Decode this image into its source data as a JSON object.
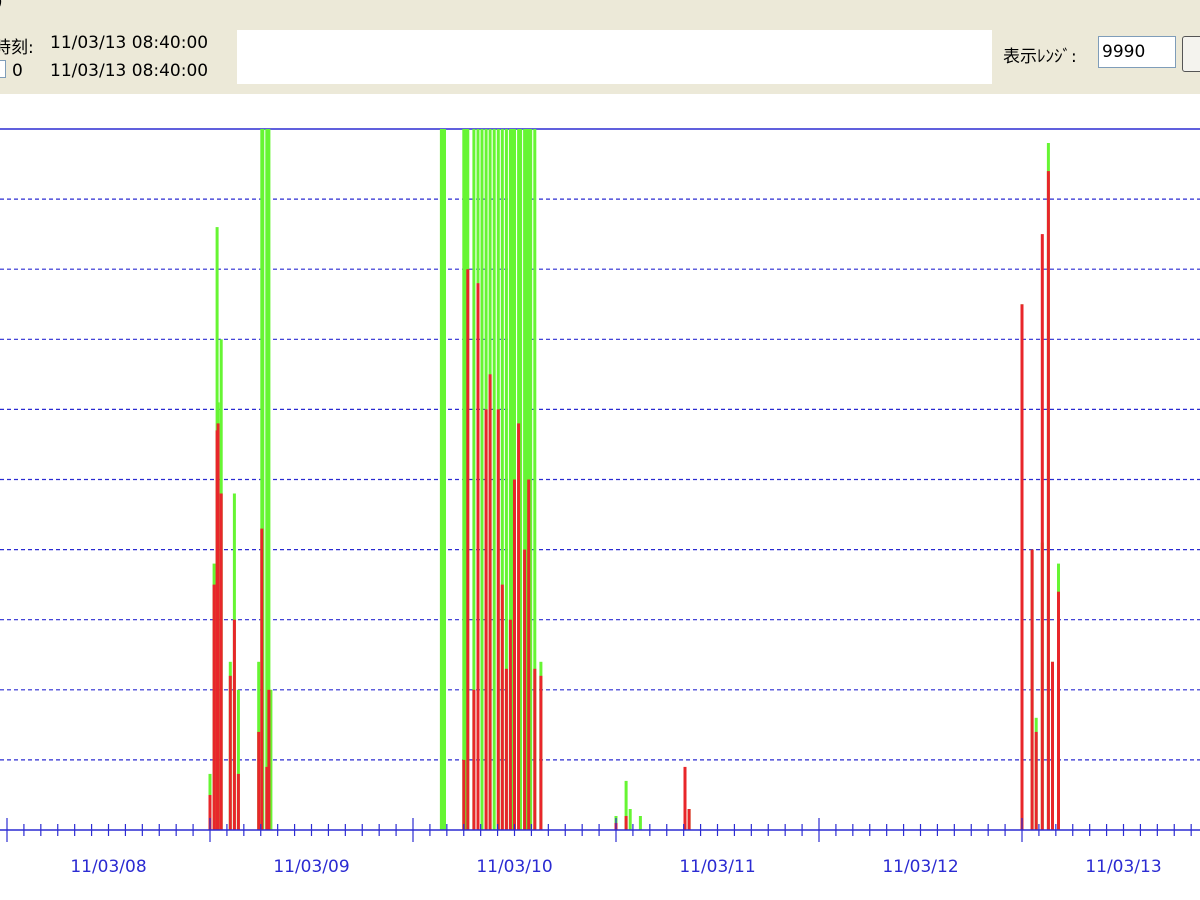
{
  "toolbar": {
    "title_fragment": ")",
    "time_label": "時刻:",
    "time_value_1": "11/03/13 08:40:00",
    "counter_value": "0",
    "time_value_2": "11/03/13 08:40:00",
    "range_label": "表示ﾚﾝｼﾞ:",
    "range_value": "9990"
  },
  "chart_data": {
    "type": "bar",
    "x_tick_labels": [
      "11/03/08",
      "11/03/09",
      "11/03/10",
      "11/03/11",
      "11/03/12",
      "11/03/13"
    ],
    "ylim": [
      0,
      9990
    ],
    "grid": "horizontal dashed",
    "colors": {
      "series_a": "#e8262a",
      "series_b": "#66f533",
      "axis": "#2b2bd2"
    },
    "series": [
      {
        "color": "#66f533",
        "values": [
          [
            1.0,
            0.08
          ],
          [
            1.02,
            0.38
          ],
          [
            1.035,
            0.86
          ],
          [
            1.04,
            0.61
          ],
          [
            1.055,
            0.7
          ],
          [
            1.1,
            0.24
          ],
          [
            1.12,
            0.48
          ],
          [
            1.14,
            0.2
          ],
          [
            1.24,
            0.24
          ],
          [
            1.255,
            1.0
          ],
          [
            1.26,
            1.0
          ],
          [
            1.28,
            1.0
          ],
          [
            1.29,
            1.0
          ],
          [
            1.3,
            0.2
          ],
          [
            2.14,
            1.0
          ],
          [
            2.15,
            1.0
          ],
          [
            2.155,
            1.0
          ],
          [
            2.25,
            1.0
          ],
          [
            2.26,
            1.0
          ],
          [
            2.27,
            1.0
          ],
          [
            2.3,
            1.0
          ],
          [
            2.32,
            1.0
          ],
          [
            2.34,
            1.0
          ],
          [
            2.36,
            1.0
          ],
          [
            2.38,
            1.0
          ],
          [
            2.4,
            1.0
          ],
          [
            2.42,
            1.0
          ],
          [
            2.44,
            1.0
          ],
          [
            2.46,
            1.0
          ],
          [
            2.48,
            1.0
          ],
          [
            2.49,
            1.0
          ],
          [
            2.5,
            1.0
          ],
          [
            2.52,
            1.0
          ],
          [
            2.53,
            1.0
          ],
          [
            2.55,
            1.0
          ],
          [
            2.56,
            1.0
          ],
          [
            2.57,
            1.0
          ],
          [
            2.58,
            1.0
          ],
          [
            2.6,
            1.0
          ],
          [
            2.63,
            0.24
          ],
          [
            3.0,
            0.02
          ],
          [
            3.05,
            0.07
          ],
          [
            3.07,
            0.03
          ],
          [
            3.12,
            0.02
          ],
          [
            3.34,
            0.05
          ],
          [
            3.36,
            0.03
          ],
          [
            5.0,
            0.75
          ],
          [
            5.05,
            0.4
          ],
          [
            5.07,
            0.16
          ],
          [
            5.1,
            0.41
          ],
          [
            5.13,
            0.98
          ],
          [
            5.15,
            0.24
          ],
          [
            5.18,
            0.38
          ]
        ]
      },
      {
        "color": "#e8262a",
        "values": [
          [
            1.0,
            0.05
          ],
          [
            1.02,
            0.35
          ],
          [
            1.035,
            0.57
          ],
          [
            1.04,
            0.58
          ],
          [
            1.055,
            0.48
          ],
          [
            1.1,
            0.22
          ],
          [
            1.12,
            0.3
          ],
          [
            1.14,
            0.08
          ],
          [
            1.24,
            0.14
          ],
          [
            1.255,
            0.43
          ],
          [
            1.28,
            0.09
          ],
          [
            1.29,
            0.2
          ],
          [
            2.25,
            0.1
          ],
          [
            2.27,
            0.8
          ],
          [
            2.3,
            0.2
          ],
          [
            2.32,
            0.78
          ],
          [
            2.36,
            0.6
          ],
          [
            2.38,
            0.65
          ],
          [
            2.42,
            0.6
          ],
          [
            2.44,
            0.35
          ],
          [
            2.46,
            0.23
          ],
          [
            2.48,
            0.3
          ],
          [
            2.5,
            0.5
          ],
          [
            2.52,
            0.58
          ],
          [
            2.55,
            0.4
          ],
          [
            2.57,
            0.5
          ],
          [
            2.6,
            0.23
          ],
          [
            2.63,
            0.22
          ],
          [
            3.0,
            0.01
          ],
          [
            3.05,
            0.02
          ],
          [
            3.34,
            0.09
          ],
          [
            3.36,
            0.03
          ],
          [
            5.0,
            0.75
          ],
          [
            5.05,
            0.4
          ],
          [
            5.07,
            0.14
          ],
          [
            5.1,
            0.85
          ],
          [
            5.13,
            0.94
          ],
          [
            5.15,
            0.24
          ],
          [
            5.18,
            0.34
          ]
        ]
      }
    ]
  }
}
